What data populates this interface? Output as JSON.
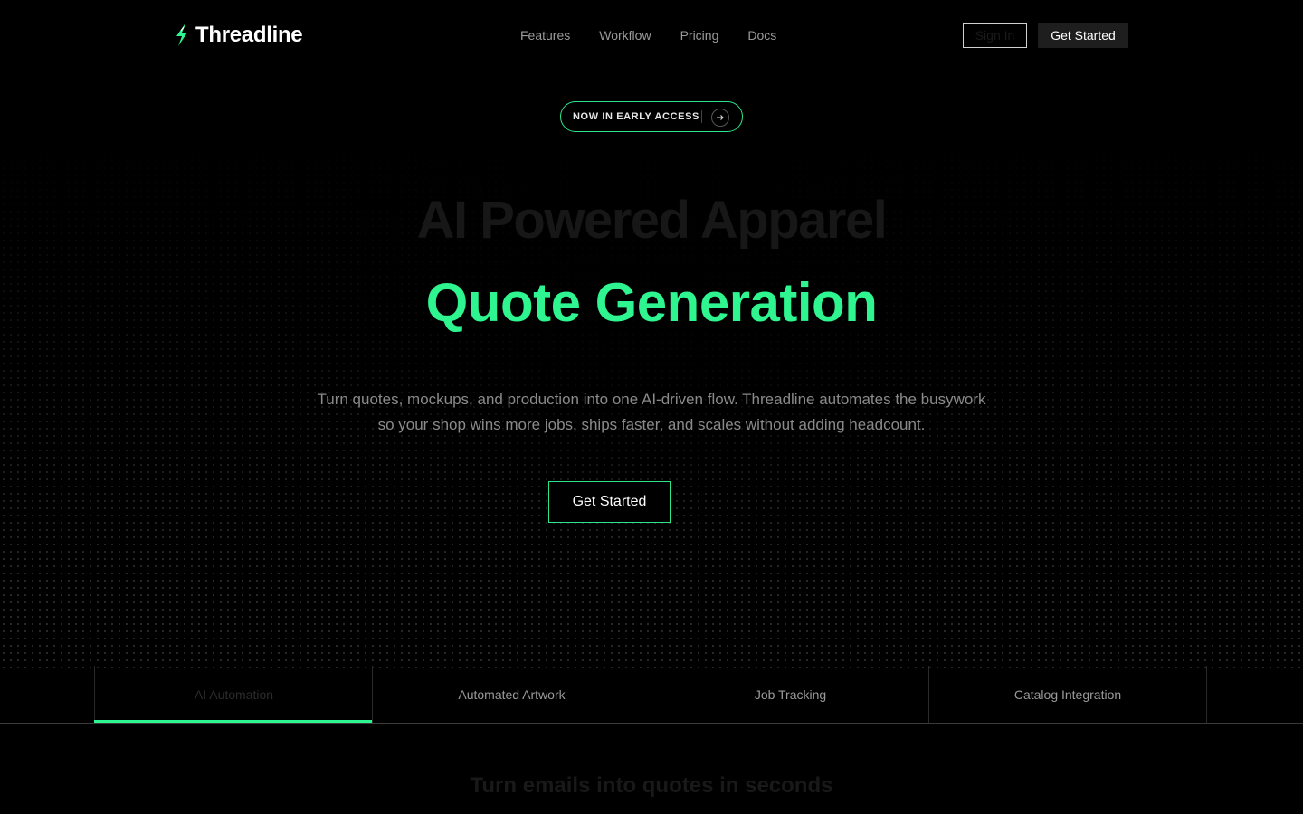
{
  "brand": {
    "name": "Threadline",
    "accent": "#2ef58f"
  },
  "nav": {
    "items": [
      "Features",
      "Workflow",
      "Pricing",
      "Docs"
    ]
  },
  "header": {
    "sign_in": "Sign In",
    "get_started": "Get Started"
  },
  "badge": {
    "text": "NOW IN EARLY ACCESS",
    "icon": "arrow-right-icon"
  },
  "hero": {
    "line1": "AI Powered Apparel",
    "line2": "Quote Generation",
    "subtitle": "Turn quotes, mockups, and production into one AI-driven flow. Threadline automates the busywork so your shop wins more jobs, ships faster, and scales without adding headcount.",
    "cta": "Get Started"
  },
  "tabs": {
    "items": [
      "AI Automation",
      "Automated Artwork",
      "Job Tracking",
      "Catalog Integration"
    ],
    "active": "AI Automation"
  },
  "section": {
    "title": "Turn emails into quotes in seconds"
  }
}
